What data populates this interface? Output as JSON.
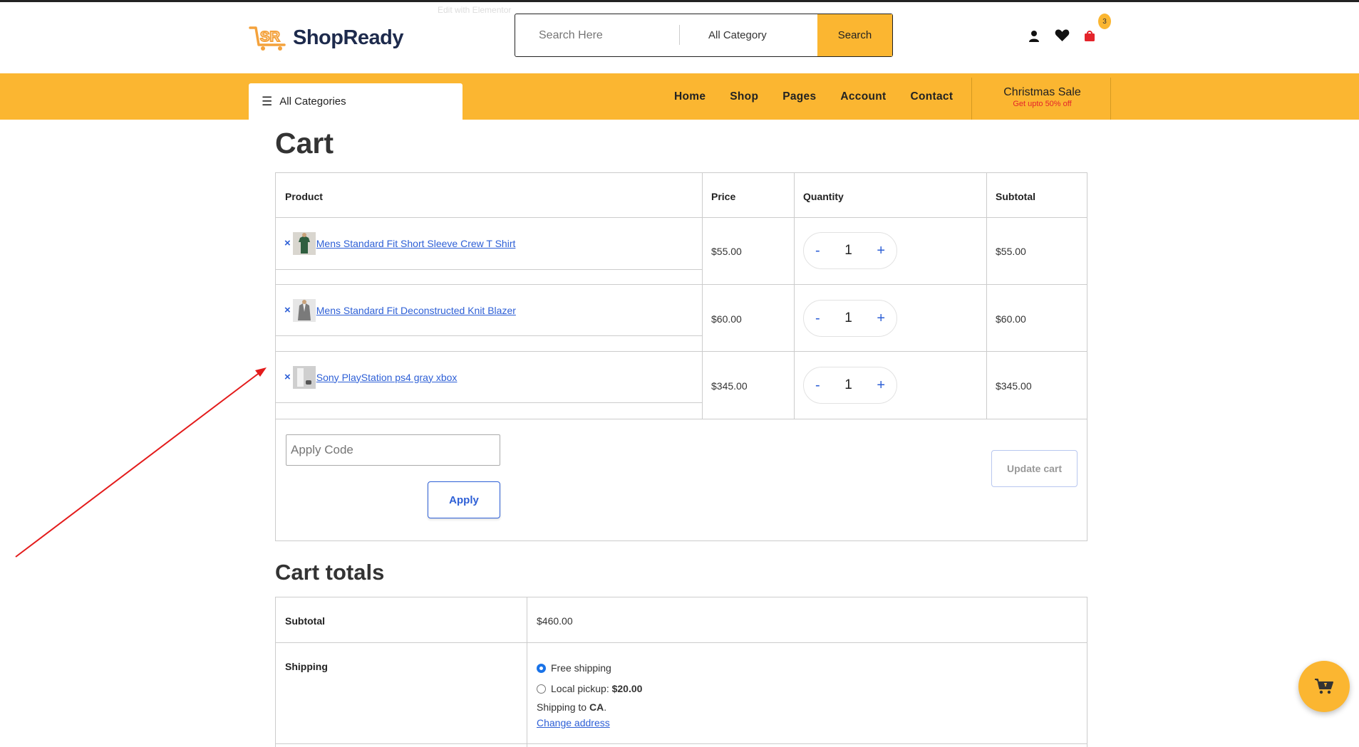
{
  "header": {
    "logo_mark": "SR",
    "logo_text": "ShopReady",
    "edit_hint": "Edit with Elementor",
    "search_placeholder": "Search Here",
    "search_category": "All Category",
    "search_button": "Search",
    "cart_count": "3"
  },
  "nav": {
    "all_categories": "All Categories",
    "links": [
      "Home",
      "Shop",
      "Pages",
      "Account",
      "Contact"
    ],
    "promo_title": "Christmas Sale",
    "promo_sub": "Get upto 50% off"
  },
  "cart": {
    "title": "Cart",
    "headers": {
      "product": "Product",
      "price": "Price",
      "quantity": "Quantity",
      "subtotal": "Subtotal"
    },
    "remove_symbol": "×",
    "qty_minus": "-",
    "qty_plus": "+",
    "items": [
      {
        "name": "Mens Standard Fit Short Sleeve Crew T Shirt",
        "price": "$55.00",
        "qty": "1",
        "subtotal": "$55.00"
      },
      {
        "name": "Mens Standard Fit Deconstructed Knit Blazer",
        "price": "$60.00",
        "qty": "1",
        "subtotal": "$60.00"
      },
      {
        "name": "Sony PlayStation ps4 gray xbox",
        "price": "$345.00",
        "qty": "1",
        "subtotal": "$345.00"
      }
    ],
    "coupon_placeholder": "Apply Code",
    "apply_button": "Apply",
    "update_button": "Update cart"
  },
  "totals": {
    "title": "Cart totals",
    "subtotal_label": "Subtotal",
    "subtotal_value": "$460.00",
    "shipping_label": "Shipping",
    "free_shipping": "Free shipping",
    "local_pickup_label": "Local pickup: ",
    "local_pickup_price": "$20.00",
    "shipping_to_prefix": "Shipping to ",
    "shipping_to_region": "CA",
    "shipping_to_suffix": ".",
    "change_address": "Change address"
  },
  "colors": {
    "accent": "#fbb631",
    "link": "#2d5fd6",
    "promo_red": "#e4242b",
    "annotation_arrow": "#e31b1b"
  },
  "icons": {
    "user": "user-icon",
    "wishlist": "heart-icon",
    "bag": "shopping-bag-icon",
    "menu": "hamburger-icon",
    "floating_cart": "cart-icon"
  }
}
